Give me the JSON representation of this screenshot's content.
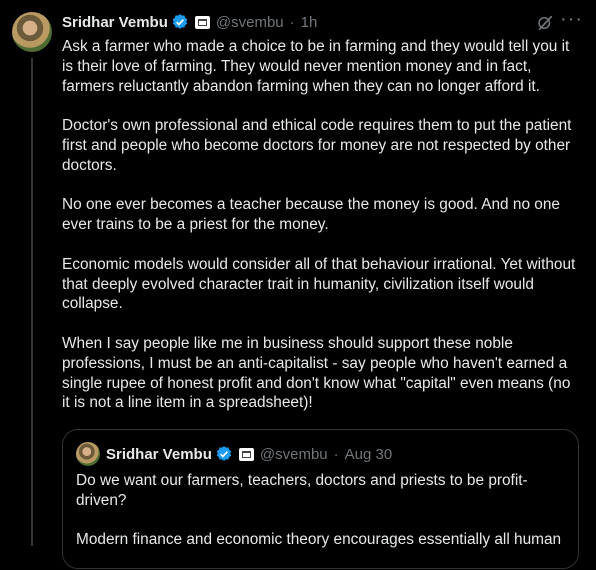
{
  "tweet": {
    "author_name": "Sridhar Vembu",
    "handle": "@svembu",
    "separator": "·",
    "time": "1h",
    "more_label": "···",
    "paragraphs": [
      "Ask a farmer who made a choice to be in farming and they would tell you it is their love of farming. They would never mention money and in fact, farmers reluctantly abandon farming when they can no longer afford it.",
      "Doctor's own professional and ethical code requires them to put the patient first and people who become doctors for money are not respected by other doctors.",
      "No one ever becomes a teacher because the money is good. And no one ever trains to be a priest for the money.",
      "Economic models would consider all of that behaviour irrational. Yet without that deeply evolved character trait in humanity, civilization itself would collapse.",
      "When I say people like me in business should support these noble professions, I must be an anti-capitalist - say people who haven't earned a single rupee of honest profit and don't know what \"capital\" even means (no it is not a line item in a spreadsheet)!"
    ]
  },
  "quoted": {
    "author_name": "Sridhar Vembu",
    "handle": "@svembu",
    "separator": "·",
    "date": "Aug 30",
    "paragraphs": [
      "Do we want our farmers, teachers, doctors and priests to be profit-driven?",
      "Modern finance and economic theory encourages essentially all human"
    ]
  },
  "colors": {
    "background": "#000000",
    "text": "#e7e9ea",
    "muted": "#71767b",
    "verified": "#1d9bf0",
    "border": "#2f3336"
  },
  "icons": [
    "verified-badge-icon",
    "affiliate-badge-icon",
    "grok-icon",
    "more-icon"
  ]
}
